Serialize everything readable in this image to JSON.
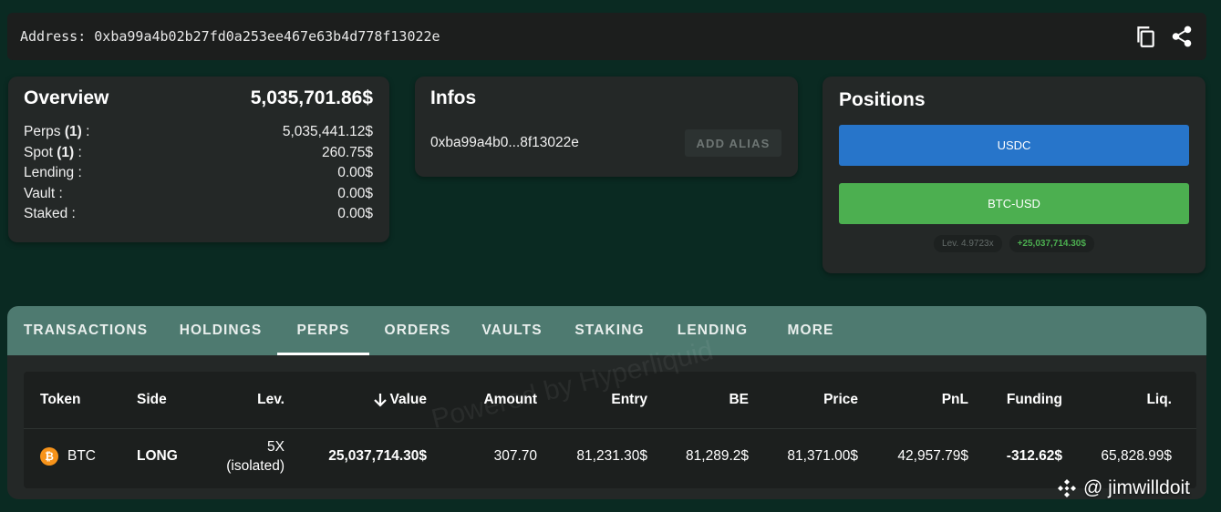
{
  "address_bar": {
    "label": "Address: 0xba99a4b02b27fd0a253ee467e63b4d778f13022e",
    "icons": [
      "copy-icon",
      "share-icon"
    ]
  },
  "overview": {
    "title": "Overview",
    "total": "5,035,701.86$",
    "rows": [
      {
        "label": "Perps",
        "count": "(1)",
        "suffix": " :",
        "value": "5,035,441.12$"
      },
      {
        "label": "Spot",
        "count": "(1)",
        "suffix": " :",
        "value": "260.75$"
      },
      {
        "label": "Lending :",
        "value": "0.00$"
      },
      {
        "label": "Vault :",
        "value": "0.00$"
      },
      {
        "label": "Staked :",
        "value": "0.00$"
      }
    ]
  },
  "infos": {
    "title": "Infos",
    "short_address": "0xba99a4b0...8f13022e",
    "add_alias_label": "ADD ALIAS"
  },
  "positions": {
    "title": "Positions",
    "usdc_label": "USDC",
    "btc_label": "BTC-USD",
    "lev_chip": "Lev. 4.9723x",
    "pnl_chip": "+25,037,714.30$"
  },
  "tabs": [
    {
      "label": "TRANSACTIONS",
      "active": false
    },
    {
      "label": "HOLDINGS",
      "active": false
    },
    {
      "label": "PERPS",
      "active": true
    },
    {
      "label": "ORDERS",
      "active": false
    },
    {
      "label": "VAULTS",
      "active": false
    },
    {
      "label": "STAKING",
      "active": false
    },
    {
      "label": "LENDING",
      "active": false
    },
    {
      "label": "MORE",
      "active": false
    }
  ],
  "table": {
    "headers": {
      "token": "Token",
      "side": "Side",
      "lev": "Lev.",
      "value": "Value",
      "amount": "Amount",
      "entry": "Entry",
      "be": "BE",
      "price": "Price",
      "pnl": "PnL",
      "funding": "Funding",
      "liq": "Liq."
    },
    "rows": [
      {
        "token": "BTC",
        "token_icon": "₿",
        "side": "LONG",
        "lev_line1": "5X",
        "lev_line2": "(isolated)",
        "value": "25,037,714.30$",
        "amount": "307.70",
        "entry": "81,231.30$",
        "be": "81,289.2$",
        "price": "81,371.00$",
        "pnl": "42,957.79$",
        "funding": "-312.62$",
        "liq": "65,828.99$"
      }
    ]
  },
  "watermark": "Powered by Hyperliquid",
  "brand": {
    "handle": "@ jimwilldoit"
  },
  "colors": {
    "background": "#0a2a22",
    "card": "#242827",
    "tabs_bar": "#4e7a70",
    "usdc": "#2775ca",
    "btc_usd": "#4caf50",
    "long": "#2e9b35",
    "negative": "#e53935",
    "btc_orange": "#f7931a"
  }
}
